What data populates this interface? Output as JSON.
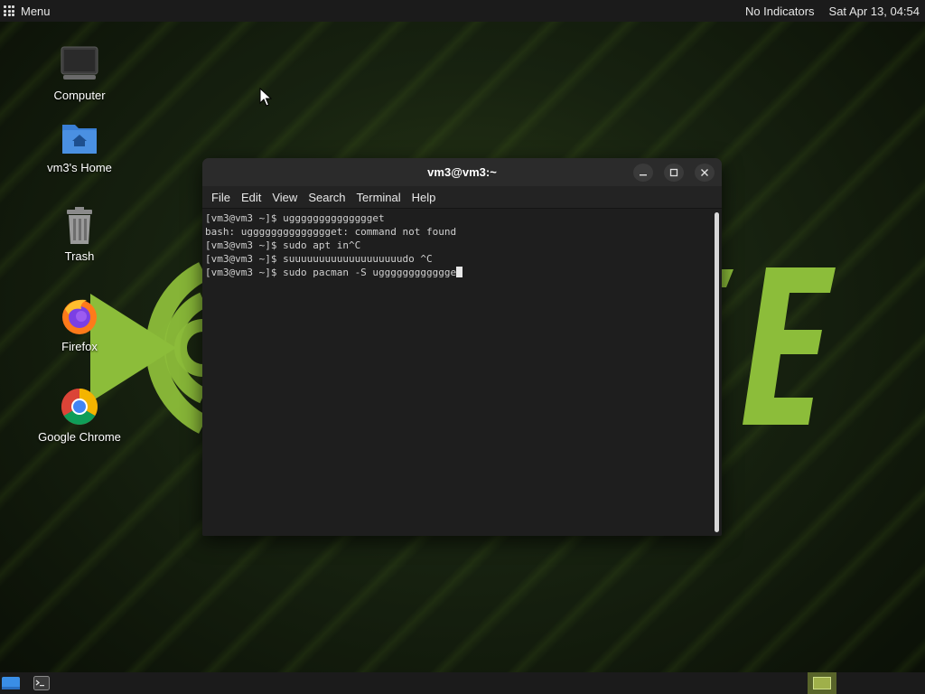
{
  "top_panel": {
    "menu_label": "Menu",
    "indicators": "No Indicators",
    "clock": "Sat Apr 13, 04:54"
  },
  "desktop_icons": [
    {
      "label": "Computer",
      "icon": "computer-icon"
    },
    {
      "label": "vm3's Home",
      "icon": "home-folder-icon"
    },
    {
      "label": "Trash",
      "icon": "trash-icon"
    },
    {
      "label": "Firefox",
      "icon": "firefox-icon"
    },
    {
      "label": "Google Chrome",
      "icon": "chrome-icon"
    }
  ],
  "terminal": {
    "title": "vm3@vm3:~",
    "menu": [
      "File",
      "Edit",
      "View",
      "Search",
      "Terminal",
      "Help"
    ],
    "lines": [
      "[vm3@vm3 ~]$ ugggggggggggggget",
      "bash: ugggggggggggggget: command not found",
      "[vm3@vm3 ~]$ sudo apt in^C",
      "[vm3@vm3 ~]$ suuuuuuuuuuuuuuuuuuudo ^C",
      "[vm3@vm3 ~]$ sudo pacman -S ugggggggggggge"
    ]
  },
  "wallpaper": {
    "accent": "#8cbd3a",
    "letter": "E"
  },
  "taskbar": {
    "items": [
      "show-desktop-icon",
      "terminal-icon"
    ],
    "workspace_color": "#9fb04a"
  }
}
